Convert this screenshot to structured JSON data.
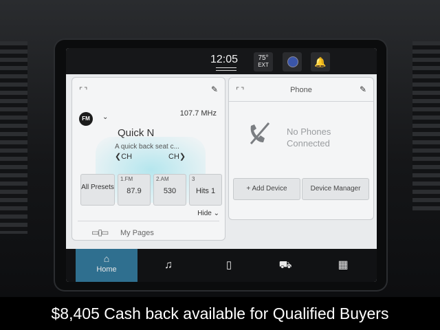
{
  "status": {
    "time": "12:05",
    "temp": "75°",
    "temp_label": "EXT"
  },
  "radio": {
    "band": "FM",
    "frequency": "107.7 MHz",
    "station": "Quick N",
    "radio_text": "A quick back seat c...",
    "ch_prev": "CH",
    "ch_next": "CH",
    "all_presets": "All Presets",
    "presets": [
      {
        "tag": "1.FM",
        "value": "87.9"
      },
      {
        "tag": "2.AM",
        "value": "530"
      },
      {
        "tag": "3",
        "value": "Hits 1"
      }
    ],
    "hide_label": "Hide",
    "my_pages": "My Pages"
  },
  "phone": {
    "title": "Phone",
    "status_line1": "No Phones",
    "status_line2": "Connected",
    "add_device": "+ Add Device",
    "device_manager": "Device Manager"
  },
  "nav": {
    "home_label": "Home"
  },
  "icons": [
    "expand-icon",
    "edit-pencil-icon",
    "voice-assistant-icon",
    "notification-bell-icon",
    "phone-disconnected-icon",
    "home-icon",
    "music-note-icon",
    "smartphone-icon",
    "vehicle-icon",
    "apps-grid-icon"
  ],
  "colors": {
    "accent": "#2f6f8f",
    "glow": "#a0e1eb",
    "screen_bg": "#e9ebed",
    "banner_bg": "#000000"
  },
  "banner": {
    "text": "$8,405 Cash back available for Qualified Buyers"
  }
}
